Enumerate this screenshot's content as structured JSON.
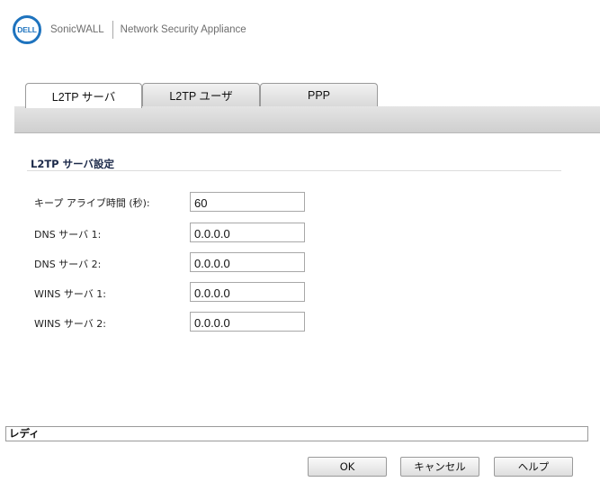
{
  "header": {
    "logo_text": "DELL",
    "brand": "SonicWALL",
    "product": "Network Security Appliance"
  },
  "tabs": [
    {
      "label": "L2TP サーバ",
      "active": true
    },
    {
      "label": "L2TP ユーザ",
      "active": false
    },
    {
      "label": "PPP",
      "active": false
    }
  ],
  "section": {
    "title": "L2TP サーバ設定"
  },
  "form": {
    "keep_alive": {
      "label": "キープ アライブ時間 (秒):",
      "value": "60"
    },
    "dns1": {
      "label": "DNS サーバ 1:",
      "value": "0.0.0.0"
    },
    "dns2": {
      "label": "DNS サーバ 2:",
      "value": "0.0.0.0"
    },
    "wins1": {
      "label": "WINS サーバ 1:",
      "value": "0.0.0.0"
    },
    "wins2": {
      "label": "WINS サーバ 2:",
      "value": "0.0.0.0"
    }
  },
  "status": {
    "text": "レディ"
  },
  "buttons": {
    "ok": "OK",
    "cancel": "キャンセル",
    "help": "ヘルプ"
  },
  "colors": {
    "dell_blue": "#1e73be",
    "section_title": "#1c2a4a"
  }
}
